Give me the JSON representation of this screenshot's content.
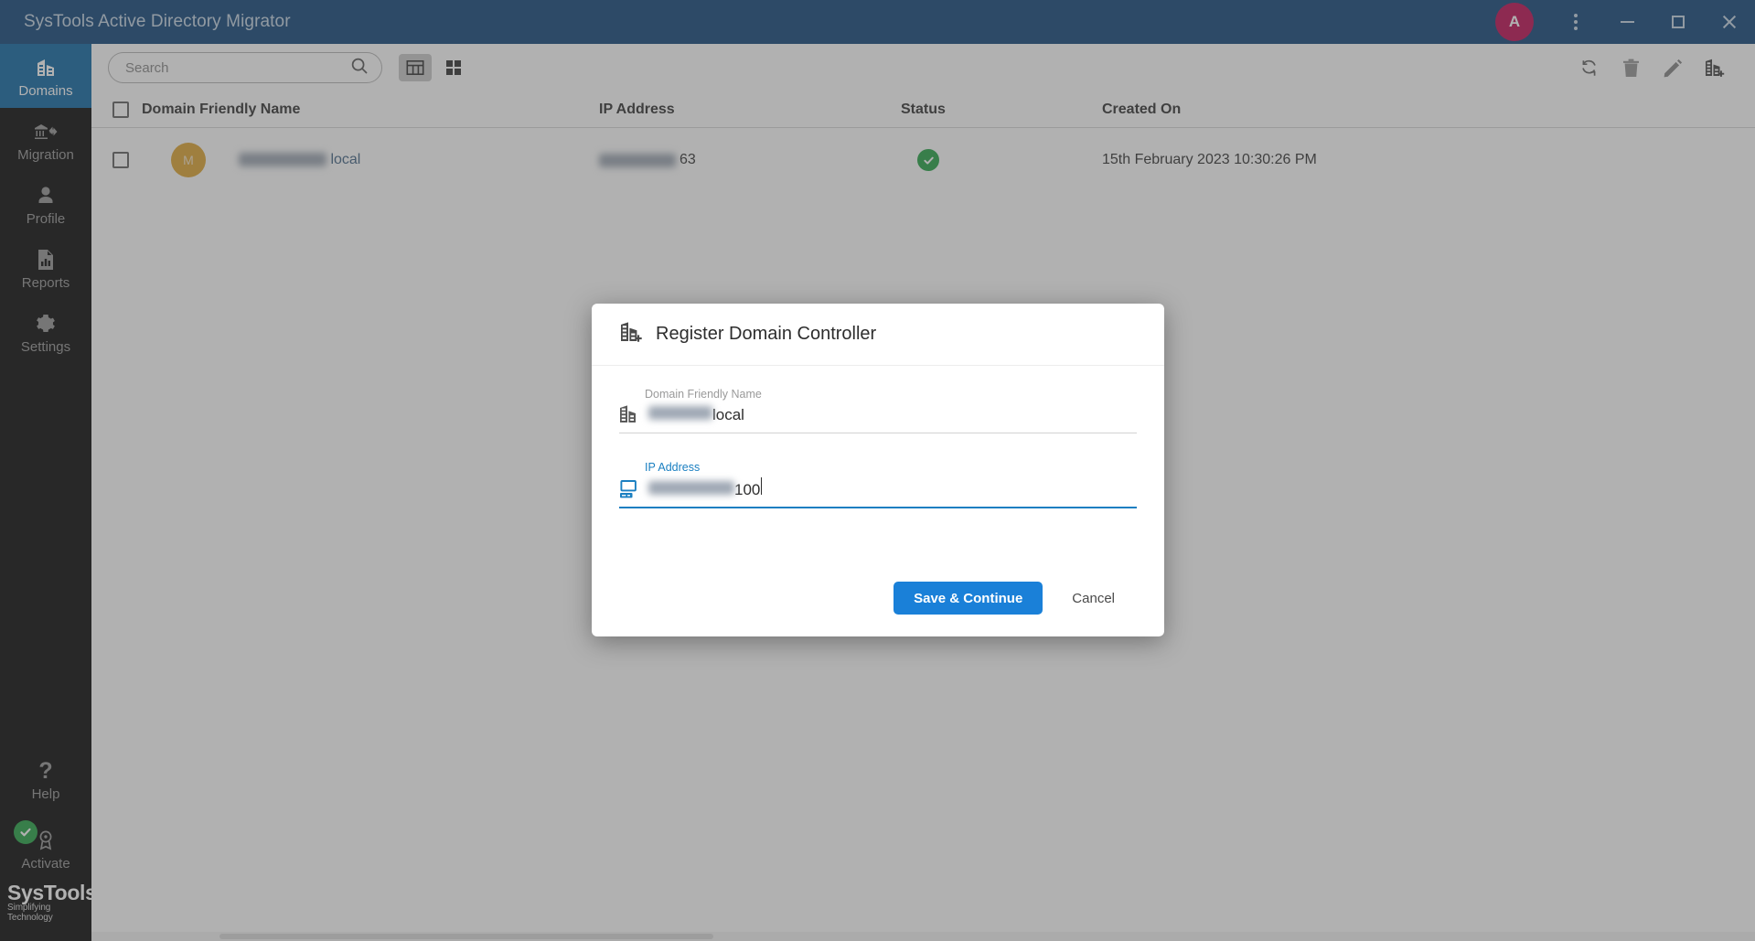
{
  "titlebar": {
    "title": "SysTools Active Directory Migrator",
    "avatar_initial": "A",
    "avatar_color": "#c2185b",
    "bg_color": "#1d4f80",
    "controls": {
      "menu": "more-options",
      "minimize": "minimize",
      "maximize": "maximize",
      "close": "close"
    }
  },
  "sidebar": {
    "bg_color": "#141414",
    "active_color": "#1a6ea8",
    "items": [
      {
        "label": "Domains",
        "icon": "building-icon",
        "active": true
      },
      {
        "label": "Migration",
        "icon": "bank-arrow-icon",
        "active": false
      },
      {
        "label": "Profile",
        "icon": "person-icon",
        "active": false
      },
      {
        "label": "Reports",
        "icon": "report-icon",
        "active": false
      },
      {
        "label": "Settings",
        "icon": "gear-icon",
        "active": false
      }
    ],
    "help": {
      "label": "Help",
      "icon": "question-mark-icon"
    },
    "activate": {
      "label": "Activate",
      "icon": "award-badge-icon",
      "status_icon": "green-check-icon",
      "status_color": "#2fa84f"
    },
    "brand": {
      "name": "SysTools",
      "registered": "®",
      "tagline": "Simplifying Technology"
    }
  },
  "toolbar": {
    "search": {
      "placeholder": "Search",
      "value": "",
      "icon": "search-icon"
    },
    "view_table": {
      "icon": "table-view-icon",
      "active": true
    },
    "view_grid": {
      "icon": "grid-view-icon",
      "active": false
    },
    "actions": [
      {
        "name": "refresh-icon",
        "label": "Refresh"
      },
      {
        "name": "delete-icon",
        "label": "Delete"
      },
      {
        "name": "edit-icon",
        "label": "Edit"
      },
      {
        "name": "add-domain-icon",
        "label": "Add Domain"
      }
    ]
  },
  "table": {
    "columns": [
      "Domain Friendly Name",
      "IP Address",
      "Status",
      "Created On"
    ],
    "rows": [
      {
        "avatar_initial": "M",
        "avatar_color": "#e0a93b",
        "domain_redacted": "████████",
        "domain_suffix": "local",
        "ip_redacted": "███ ███ █",
        "ip_suffix": "63",
        "status": "verified",
        "status_color": "#2fa84f",
        "created_on": "15th February 2023 10:30:26 PM"
      }
    ]
  },
  "modal": {
    "title": "Register Domain Controller",
    "title_icon": "building-plus-icon",
    "fields": [
      {
        "label": "Domain Friendly Name",
        "icon": "building-icon",
        "value_redacted": "██████",
        "value_suffix": "local",
        "focused": false
      },
      {
        "label": "IP Address",
        "icon": "computer-icon",
        "value_redacted": "███ ███ █",
        "value_suffix": "100",
        "focused": true
      }
    ],
    "primary_button": "Save & Continue",
    "cancel_button": "Cancel",
    "primary_color": "#1a80d8",
    "focus_color": "#1a7fc1"
  }
}
